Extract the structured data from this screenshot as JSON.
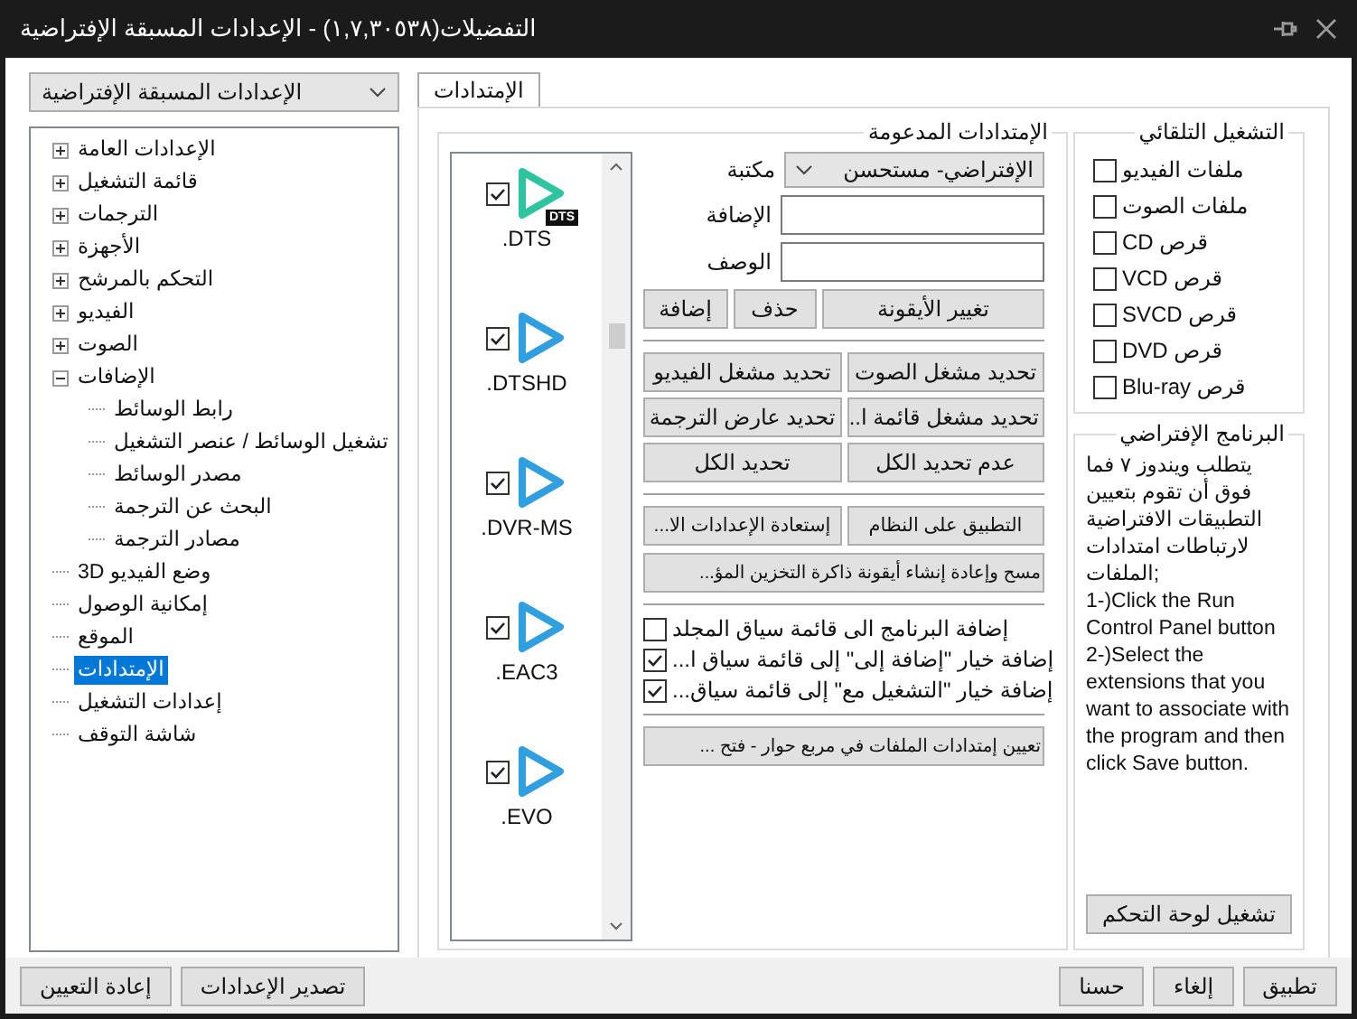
{
  "window": {
    "title": "التفضيلات(١,٧,٣٠٥٣٨) - الإعدادات المسبقة الإفتراضية"
  },
  "preset_select": {
    "value": "الإعدادات المسبقة الإفتراضية"
  },
  "tree": [
    {
      "label": "الإعدادات العامة",
      "kind": "group",
      "expanded": false,
      "selected": false
    },
    {
      "label": "قائمة التشغيل",
      "kind": "group",
      "expanded": false,
      "selected": false
    },
    {
      "label": "الترجمات",
      "kind": "group",
      "expanded": false,
      "selected": false
    },
    {
      "label": "الأجهزة",
      "kind": "group",
      "expanded": false,
      "selected": false
    },
    {
      "label": "التحكم بالمرشح",
      "kind": "group",
      "expanded": false,
      "selected": false
    },
    {
      "label": "الفيديو",
      "kind": "group",
      "expanded": false,
      "selected": false
    },
    {
      "label": "الصوت",
      "kind": "group",
      "expanded": false,
      "selected": false
    },
    {
      "label": "الإضافات",
      "kind": "group",
      "expanded": true,
      "selected": false,
      "children": [
        {
          "label": "رابط الوسائط",
          "kind": "item",
          "selected": false
        },
        {
          "label": "تشغيل الوسائط / عنصر التشغيل",
          "kind": "item",
          "selected": false
        },
        {
          "label": "مصدر الوسائط",
          "kind": "item",
          "selected": false
        },
        {
          "label": "البحث عن الترجمة",
          "kind": "item",
          "selected": false
        },
        {
          "label": "مصادر الترجمة",
          "kind": "item",
          "selected": false
        }
      ]
    },
    {
      "label": "وضع الفيديو 3D",
      "kind": "item",
      "selected": false
    },
    {
      "label": "إمكانية الوصول",
      "kind": "item",
      "selected": false
    },
    {
      "label": "الموقع",
      "kind": "item",
      "selected": false
    },
    {
      "label": "الإمتدادات",
      "kind": "item",
      "selected": true
    },
    {
      "label": "إعدادات التشغيل",
      "kind": "item",
      "selected": false
    },
    {
      "label": "شاشة التوقف",
      "kind": "item",
      "selected": false
    }
  ],
  "tabs": [
    {
      "label": "الإمتدادات",
      "selected": true
    }
  ],
  "extensions": {
    "title": "الإمتدادات المدعومة",
    "items": [
      {
        "label": ".DTS",
        "checked": true,
        "color": "#2ec4a0",
        "badge": "DTS"
      },
      {
        "label": ".DTSHD",
        "checked": true,
        "color": "#2f9fe0"
      },
      {
        "label": ".DVR-MS",
        "checked": true,
        "color": "#2f9fe0"
      },
      {
        "label": ".EAC3",
        "checked": true,
        "color": "#2f9fe0"
      },
      {
        "label": ".EVO",
        "checked": true,
        "color": "#2f9fe0"
      }
    ]
  },
  "form": [
    {
      "label": "مكتبة",
      "kind": "select",
      "value": "الإفتراضي- مستحسن"
    },
    {
      "label": "الإضافة",
      "kind": "text"
    },
    {
      "label": "الوصف",
      "kind": "text"
    }
  ],
  "icon_buttons": [
    "تغيير الأيقونة",
    "حذف",
    "إضافة"
  ],
  "assign_buttons": [
    "تحديد مشغل الصوت",
    "تحديد مشغل الفيديو",
    "تحديد مشغل قائمة ا...",
    "تحديد عارض الترجمة",
    "عدم تحديد الكل",
    "تحديد الكل"
  ],
  "system_buttons": [
    "التطبيق على النظام",
    "إستعادة الإعدادات الا..."
  ],
  "cache_button": "مسح وإعادة إنشاء أيقونة ذاكرة التخزين المؤ...",
  "context_options": [
    {
      "label": "إضافة البرنامج الى قائمة سياق المجلد",
      "checked": false
    },
    {
      "label": "إضافة خيار \"إضافة إلى\" إلى قائمة سياق ا...",
      "checked": true
    },
    {
      "label": "إضافة خيار \"التشغيل مع\" إلى قائمة سياق...",
      "checked": true
    }
  ],
  "dialog_button": "تعيين إمتدادات الملفات في مربع حوار - فتح ...",
  "autoplay": {
    "title": "التشغيل التلقائي",
    "items": [
      {
        "label": "ملفات الفيديو",
        "checked": false
      },
      {
        "label": "ملفات الصوت",
        "checked": false
      },
      {
        "label": "قرص CD",
        "checked": false
      },
      {
        "label": "قرص VCD",
        "checked": false
      },
      {
        "label": "قرص SVCD",
        "checked": false
      },
      {
        "label": "قرص DVD",
        "checked": false
      },
      {
        "label": "قرص Blu-ray",
        "checked": false
      }
    ]
  },
  "default_program": {
    "title": "البرنامج الإفتراضي",
    "text": "يتطلب ويندوز ٧ فما فوق أن تقوم بتعيين التطبيقات الافتراضية لارتباطات امتدادات الملفات;\n1-)Click the Run Control Panel button\n2-)Select the extensions that you want to associate with the program and then click Save button.",
    "button": "تشغيل لوحة التحكم"
  },
  "footer": {
    "left_buttons": [
      "تصدير الإعدادات",
      "إعادة التعيين"
    ],
    "right_buttons": [
      "تطبيق",
      "إلغاء",
      "حسنا"
    ]
  }
}
